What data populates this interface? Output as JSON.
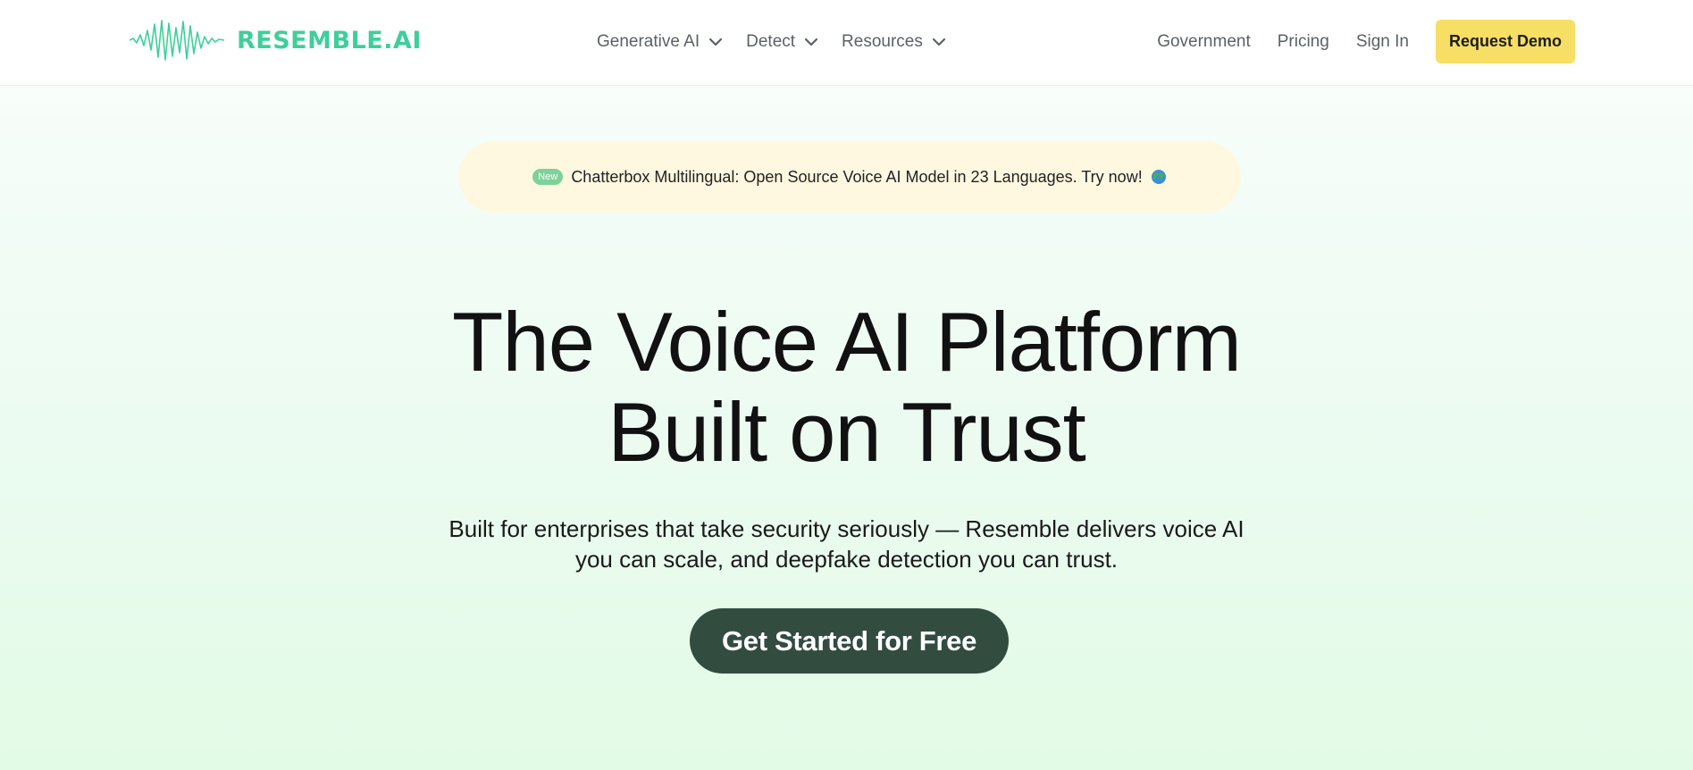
{
  "brand": {
    "name": "RESEMBLE.AI",
    "color": "#3ecf9a"
  },
  "nav": {
    "dropdowns": [
      {
        "label": "Generative AI",
        "icon": "chevron-down-icon"
      },
      {
        "label": "Detect",
        "icon": "chevron-down-icon"
      },
      {
        "label": "Resources",
        "icon": "chevron-down-icon"
      }
    ],
    "links": [
      "Government",
      "Pricing",
      "Sign In"
    ],
    "demo_button": "Request Demo"
  },
  "announcement": {
    "badge": "New",
    "text": "Chatterbox Multilingual: Open Source Voice AI Model in 23 Languages. Try now!",
    "icon": "globe-icon"
  },
  "hero": {
    "title_line1": "The Voice AI Platform",
    "title_line2": "Built on Trust",
    "subtitle_line1": "Built for enterprises that take security seriously — Resemble delivers voice AI",
    "subtitle_line2": "you can scale, and deepfake detection you can trust.",
    "cta": "Get Started for Free"
  },
  "colors": {
    "accent_yellow": "#f7de64",
    "cta_dark_green": "#324c40",
    "announcement_bg": "#fff8e1",
    "badge_green": "#7fd19a"
  }
}
